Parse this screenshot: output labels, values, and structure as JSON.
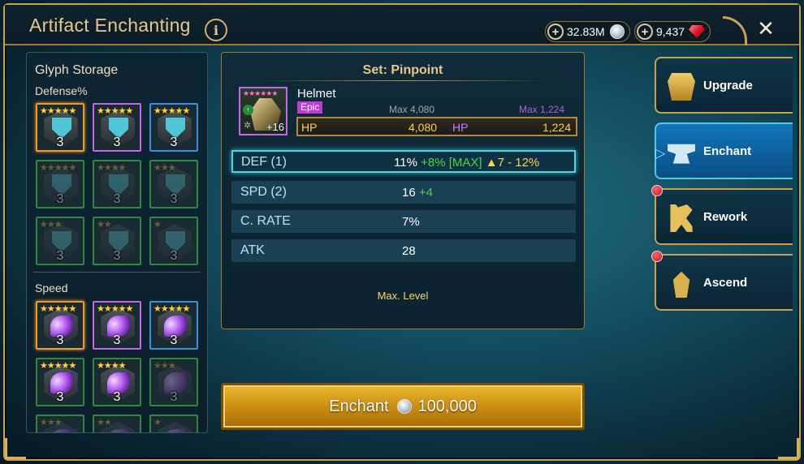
{
  "header": {
    "title": "Artifact Enchanting",
    "info_label": "i",
    "silver_amount": "32.83M",
    "gems_amount": "9,437",
    "close_label": "✕"
  },
  "glyph_storage": {
    "title": "Glyph Storage",
    "defense_label": "Defense%",
    "speed_label": "Speed",
    "defense_glyphs": [
      {
        "stars": "★★★★★",
        "count": "3",
        "rarity": "orange",
        "dim": false
      },
      {
        "stars": "★★★★★",
        "count": "3",
        "rarity": "purple",
        "dim": false
      },
      {
        "stars": "★★★★★",
        "count": "3",
        "rarity": "blue",
        "dim": false
      },
      {
        "stars": "★★★★★",
        "count": "3",
        "rarity": "green",
        "dim": true
      },
      {
        "stars": "★★★★",
        "count": "3",
        "rarity": "green",
        "dim": true
      },
      {
        "stars": "★★★",
        "count": "3",
        "rarity": "green",
        "dim": true
      },
      {
        "stars": "★★★",
        "count": "3",
        "rarity": "green",
        "dim": true
      },
      {
        "stars": "★★",
        "count": "3",
        "rarity": "green",
        "dim": true
      },
      {
        "stars": "★",
        "count": "3",
        "rarity": "green",
        "dim": true
      }
    ],
    "speed_glyphs": [
      {
        "stars": "★★★★★",
        "count": "3",
        "rarity": "orange",
        "dim": false
      },
      {
        "stars": "★★★★★",
        "count": "3",
        "rarity": "purple",
        "dim": false
      },
      {
        "stars": "★★★★★",
        "count": "3",
        "rarity": "blue",
        "dim": false
      },
      {
        "stars": "★★★★★",
        "count": "3",
        "rarity": "green",
        "dim": false
      },
      {
        "stars": "★★★★",
        "count": "3",
        "rarity": "green",
        "dim": false
      },
      {
        "stars": "★★★",
        "count": "3",
        "rarity": "green",
        "dim": true
      },
      {
        "stars": "★★★",
        "count": "",
        "rarity": "green",
        "dim": true
      },
      {
        "stars": "★★",
        "count": "",
        "rarity": "green",
        "dim": true
      },
      {
        "stars": "★",
        "count": "",
        "rarity": "green",
        "dim": true
      }
    ]
  },
  "artifact": {
    "set_label": "Set: Pinpoint",
    "name": "Helmet",
    "rarity": "Epic",
    "stars": "★★★★★★",
    "level": "+16",
    "max_main": "Max 4,080",
    "max_sub": "Max 1,224",
    "primary_label": "HP",
    "primary_value": "4,080",
    "secondary_label": "HP",
    "secondary_value": "1,224"
  },
  "substats": [
    {
      "name": "DEF (1)",
      "value": "11%",
      "bonus": "+8% [MAX]",
      "range": "▲7 - 12%",
      "selected": true
    },
    {
      "name": "SPD (2)",
      "value": "16",
      "bonus": "+4",
      "range": "",
      "selected": false
    },
    {
      "name": "C. RATE",
      "value": "7%",
      "bonus": "",
      "range": "",
      "selected": false
    },
    {
      "name": "ATK",
      "value": "28",
      "bonus": "",
      "range": "",
      "selected": false
    }
  ],
  "max_level_text": "Max. Level",
  "enchant_button": {
    "label": "Enchant",
    "cost": "100,000"
  },
  "tabs": [
    {
      "label": "Upgrade",
      "icon": "armor-icon",
      "active": false,
      "alert": false
    },
    {
      "label": "Enchant",
      "icon": "anvil-icon",
      "active": true,
      "alert": false
    },
    {
      "label": "Rework",
      "icon": "tools-icon",
      "active": false,
      "alert": true
    },
    {
      "label": "Ascend",
      "icon": "ascend-icon",
      "active": false,
      "alert": true
    }
  ],
  "colors": {
    "gold": "#e6c889",
    "active_tab": "#1176b8",
    "bonus_green": "#48d64a",
    "bonus_yellow": "#ffcf4a",
    "epic_purple": "#c23ad6"
  }
}
